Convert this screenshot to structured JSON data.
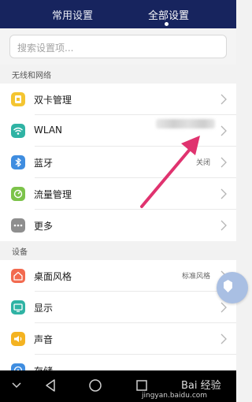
{
  "tabs": [
    {
      "label": "常用设置"
    },
    {
      "label": "全部设置"
    }
  ],
  "search": {
    "placeholder": "搜索设置项..."
  },
  "sections": [
    {
      "title": "无线和网络",
      "items": [
        {
          "label": "双卡管理",
          "value": "",
          "icon": "sim-card-icon",
          "color": "#f4c531"
        },
        {
          "label": "WLAN",
          "value": "",
          "icon": "wifi-icon",
          "color": "#2fb3a4"
        },
        {
          "label": "蓝牙",
          "value": "关闭",
          "icon": "bluetooth-icon",
          "color": "#3f8de0"
        },
        {
          "label": "流量管理",
          "value": "",
          "icon": "data-usage-icon",
          "color": "#7cc34a"
        },
        {
          "label": "更多",
          "value": "",
          "icon": "more-icon",
          "color": "#8e8e8e"
        }
      ]
    },
    {
      "title": "设备",
      "items": [
        {
          "label": "桌面风格",
          "value": "标准风格",
          "icon": "home-style-icon",
          "color": "#f26a4f"
        },
        {
          "label": "显示",
          "value": "",
          "icon": "display-icon",
          "color": "#2fb3a4"
        },
        {
          "label": "声音",
          "value": "",
          "icon": "sound-icon",
          "color": "#f4b321"
        },
        {
          "label": "存储",
          "value": "",
          "icon": "storage-icon",
          "color": "#3f8de0"
        }
      ]
    }
  ],
  "watermark": {
    "title": "Bai 经验",
    "url": "jingyan.baidu.com"
  },
  "colors": {
    "header": "#17245e",
    "arrow": "#e0336f"
  }
}
